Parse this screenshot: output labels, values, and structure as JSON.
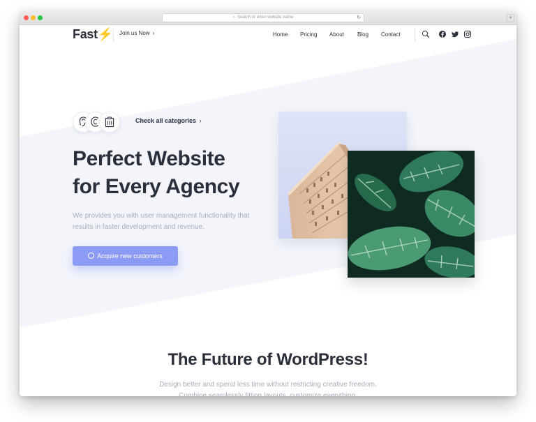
{
  "browser": {
    "address_placeholder": "Search or enter website name"
  },
  "nav": {
    "logo_text": "Fast",
    "logo_mark": "⚡",
    "join_label": "Join us Now",
    "menu": [
      "Home",
      "Pricing",
      "About",
      "Blog",
      "Contact"
    ],
    "icons": [
      "search-icon",
      "facebook-icon",
      "twitter-icon",
      "instagram-icon"
    ]
  },
  "hero": {
    "categories_link": "Check all categories",
    "category_icons": [
      "ear-icon",
      "coin-icon",
      "clipboard-icon"
    ],
    "title_line1": "Perfect Website",
    "title_line2": "for Every Agency",
    "subtitle": "We provides you with user management functionality that results in faster development and revenue.",
    "cta_label": "Acquire new customers"
  },
  "section": {
    "title": "The Future of WordPress!",
    "subtitle": "Design better and spend less time without restricting creative freedom. Combine seamlessly fitting layouts, customize everything."
  },
  "colors": {
    "accent": "#8c9cf5",
    "logo_bolt": "#f4b51c",
    "heading": "#2b2f3a",
    "muted": "#a7adbb",
    "band": "#f3f5fb"
  }
}
